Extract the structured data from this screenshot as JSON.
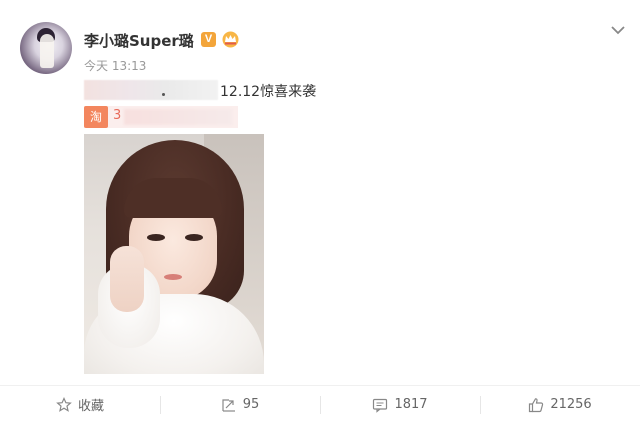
{
  "post": {
    "author": {
      "name": "李小璐Super璐",
      "verified_badge": "V",
      "avatar_icon": "avatar-image"
    },
    "timestamp": "今天 13:13",
    "text": "12.12惊喜来袭",
    "link_chip": {
      "icon_label": "淘",
      "text": "3"
    },
    "colors": {
      "name_color": "#333333",
      "verified_badge": "#f3a53a",
      "taobao_orange": "#f3865e",
      "muted": "#999999"
    }
  },
  "actions": [
    {
      "icon": "star-icon",
      "label": "收藏"
    },
    {
      "icon": "share-icon",
      "label": "95"
    },
    {
      "icon": "comment-icon",
      "label": "1817"
    },
    {
      "icon": "like-icon",
      "label": "21256"
    }
  ]
}
